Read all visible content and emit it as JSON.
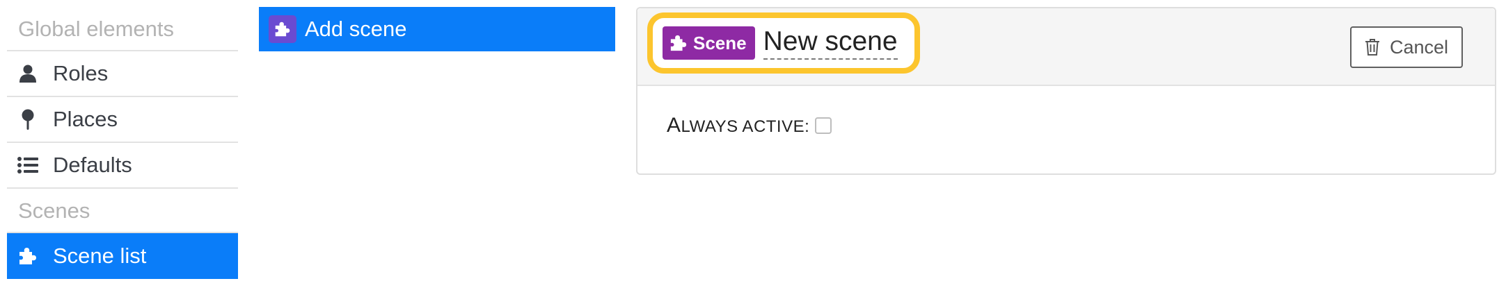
{
  "sidebar": {
    "global_header": "Global elements",
    "items": [
      {
        "label": "Roles",
        "icon": "user-icon"
      },
      {
        "label": "Places",
        "icon": "pin-icon"
      },
      {
        "label": "Defaults",
        "icon": "list-icon"
      }
    ],
    "scenes_header": "Scenes",
    "scene_list": {
      "label": "Scene list",
      "icon": "puzzle-icon",
      "active": true
    }
  },
  "middle": {
    "add_scene_label": "Add scene"
  },
  "panel": {
    "badge_label": "Scene",
    "scene_name": "New scene",
    "cancel_label": "Cancel",
    "always_active_label_first": "A",
    "always_active_label_rest": "LWAYS ACTIVE:"
  },
  "colors": {
    "accent_blue": "#0a7df9",
    "badge_purple": "#8e2aa4",
    "highlight_yellow": "#fcc52e",
    "add_icon_bg": "#6a4bd1"
  }
}
